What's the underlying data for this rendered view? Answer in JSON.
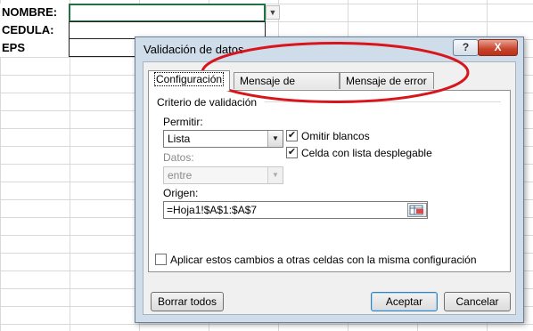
{
  "sheet": {
    "labels": [
      "NOMBRE:",
      "CEDULA:",
      "EPS"
    ]
  },
  "dialog": {
    "title": "Validación de datos",
    "help_label": "?",
    "close_label": "X",
    "tabs": [
      {
        "label": "Configuración",
        "active": true
      },
      {
        "label": "Mensaje de entrada",
        "active": false
      },
      {
        "label": "Mensaje de error",
        "active": false
      }
    ],
    "group_title": "Criterio de validación",
    "permitir_label": "Permitir:",
    "permitir_value": "Lista",
    "datos_label": "Datos:",
    "datos_value": "entre",
    "omitir_blancos_label": "Omitir blancos",
    "omitir_blancos_checked": true,
    "celda_lista_label": "Celda con lista desplegable",
    "celda_lista_checked": true,
    "origen_label": "Origen:",
    "origen_value": "=Hoja1!$A$1:$A$7",
    "aplicar_label": "Aplicar estos cambios a otras celdas con la misma configuración",
    "aplicar_checked": false,
    "borrar_label": "Borrar todos",
    "aceptar_label": "Aceptar",
    "cancelar_label": "Cancelar"
  },
  "colors": {
    "annotation": "#d8141c",
    "active_cell_border": "#217346"
  }
}
